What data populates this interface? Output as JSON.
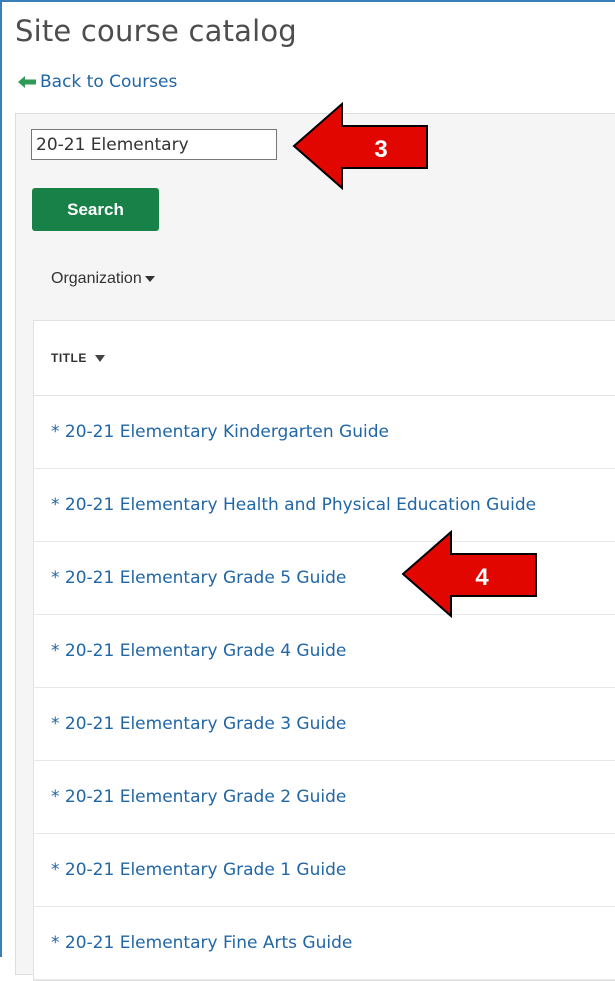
{
  "page": {
    "title": "Site course catalog",
    "back_link": "Back to Courses"
  },
  "search": {
    "value": "20-21 Elementary",
    "button_label": "Search"
  },
  "filters": {
    "organization_label": "Organization"
  },
  "table": {
    "column_title": "TITLE",
    "rows": [
      "* 20-21 Elementary Kindergarten Guide",
      "* 20-21 Elementary Health and Physical Education Guide",
      "* 20-21 Elementary Grade 5 Guide",
      "* 20-21 Elementary Grade 4 Guide",
      "* 20-21 Elementary Grade 3 Guide",
      "* 20-21 Elementary Grade 2 Guide",
      "* 20-21 Elementary Grade 1 Guide",
      "* 20-21 Elementary Fine Arts Guide"
    ]
  },
  "annotations": {
    "step_search": "3",
    "step_select": "4",
    "arrow_color": "#e10600"
  },
  "colors": {
    "link": "#2166a6",
    "button": "#178148",
    "frame": "#3a7fb8"
  }
}
